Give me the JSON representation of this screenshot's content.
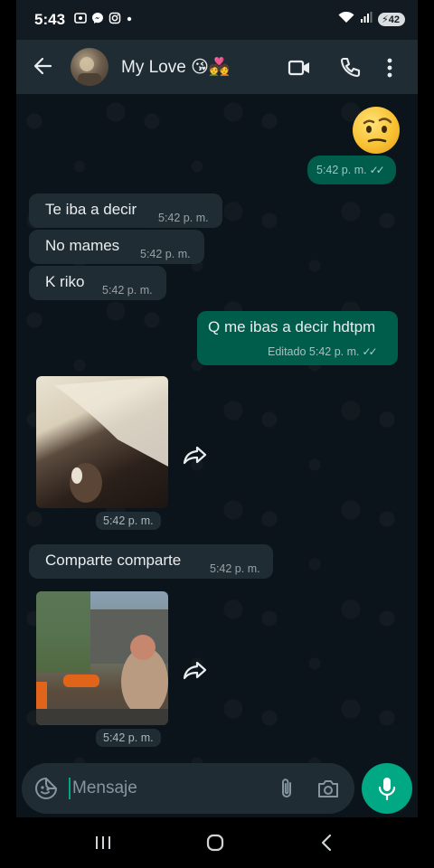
{
  "status_bar": {
    "time": "5:43",
    "battery": "42",
    "icons": [
      "screen-record-icon",
      "messenger-icon",
      "instagram-icon",
      "dot-icon",
      "wifi-icon",
      "signal-icon"
    ]
  },
  "header": {
    "contact_name": "My Love",
    "name_emojis": "😘💑",
    "icons": [
      "back-arrow-icon",
      "video-call-icon",
      "phone-icon",
      "more-vert-icon"
    ]
  },
  "messages": [
    {
      "type": "emoji",
      "direction": "out",
      "content": "🤨",
      "time": "5:42 p. m.",
      "status": "read"
    },
    {
      "type": "text",
      "direction": "in",
      "text": "Te iba a decir",
      "time": "5:42 p. m."
    },
    {
      "type": "text",
      "direction": "in",
      "text": "No mames",
      "time": "5:42 p. m."
    },
    {
      "type": "text",
      "direction": "in",
      "text": "K riko",
      "time": "5:42 p. m."
    },
    {
      "type": "text",
      "direction": "out",
      "text": "Q me ibas a decir hdtpm",
      "edited_label": "Editado",
      "time": "5:42 p. m.",
      "status": "read"
    },
    {
      "type": "media",
      "direction": "in",
      "time": "5:42 p. m."
    },
    {
      "type": "text",
      "direction": "in",
      "text": "Comparte comparte",
      "time": "5:42 p. m."
    },
    {
      "type": "media",
      "direction": "in",
      "time": "5:42 p. m."
    }
  ],
  "composer": {
    "placeholder": "Mensaje",
    "icons": [
      "sticker-icon",
      "attach-icon",
      "camera-icon",
      "mic-icon"
    ]
  },
  "navbar": {
    "icons": [
      "recent-apps-icon",
      "home-icon",
      "back-icon"
    ]
  },
  "colors": {
    "background": "#0b141a",
    "header": "#1f2c34",
    "incoming": "#1f2c34",
    "outgoing": "#005c4b",
    "accent": "#00a884"
  }
}
